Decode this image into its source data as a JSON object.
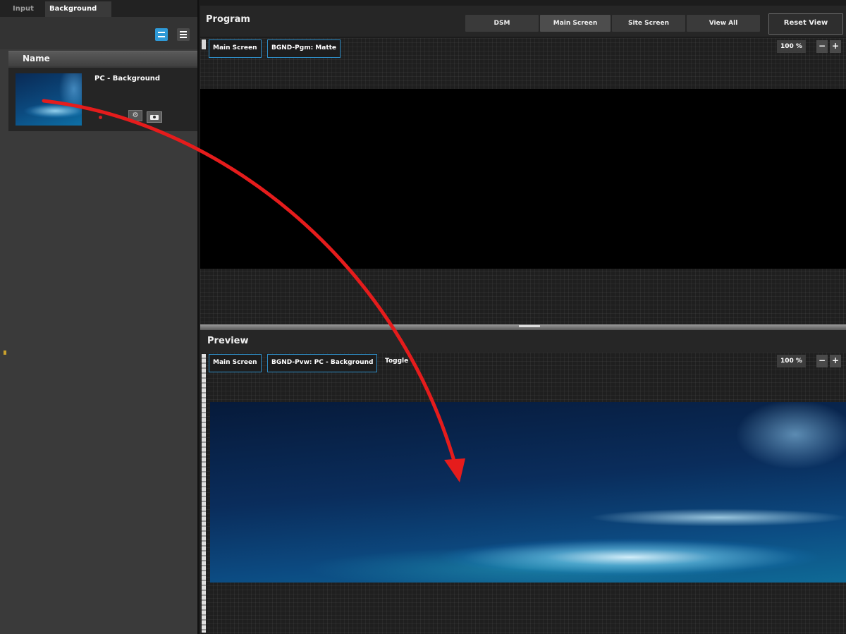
{
  "left_panel": {
    "tabs": [
      {
        "label": "Input"
      },
      {
        "label": "Background"
      }
    ],
    "column_header": "Name",
    "item": {
      "name": "PC - Background",
      "status_color": "#d42020"
    }
  },
  "program": {
    "title": "Program",
    "view_buttons": [
      "DSM",
      "Main Screen",
      "Site Screen",
      "View All"
    ],
    "reset_label": "Reset View",
    "chips": [
      "Main Screen",
      "BGND-Pgm: Matte"
    ],
    "zoom": "100 %",
    "zoom_out": "−",
    "zoom_in": "+"
  },
  "preview": {
    "title": "Preview",
    "chips": [
      "Main Screen",
      "BGND-Pvw: PC - Background"
    ],
    "toggle_label": "Toggle",
    "zoom": "100 %",
    "zoom_out": "−",
    "zoom_in": "+"
  },
  "colors": {
    "accent_blue": "#2f9ad8",
    "chip_border": "#2f8fc8",
    "arrow_red": "#e51c1c"
  }
}
